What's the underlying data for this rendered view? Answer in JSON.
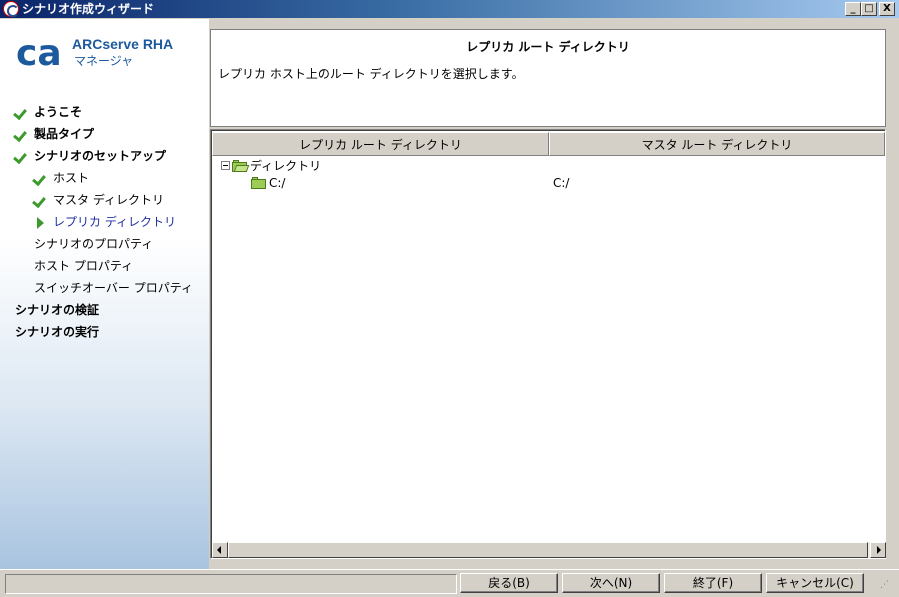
{
  "window": {
    "title": "シナリオ作成ウィザード",
    "controls": {
      "minimize": "_",
      "maximize": "□",
      "close": "X"
    }
  },
  "brand": {
    "logo_text": "ca",
    "product": "ARCserve RHA",
    "subtitle": "マネージャ"
  },
  "steps": [
    {
      "label": "ようこそ",
      "status": "done",
      "level": 0
    },
    {
      "label": "製品タイプ",
      "status": "done",
      "level": 0
    },
    {
      "label": "シナリオのセットアップ",
      "status": "done",
      "level": 0
    },
    {
      "label": "ホスト",
      "status": "done",
      "level": 1
    },
    {
      "label": "マスタ ディレクトリ",
      "status": "done",
      "level": 1
    },
    {
      "label": "レプリカ ディレクトリ",
      "status": "current",
      "level": 1
    },
    {
      "label": "シナリオのプロパティ",
      "status": "pending",
      "level": 1
    },
    {
      "label": "ホスト プロパティ",
      "status": "pending",
      "level": 1
    },
    {
      "label": "スイッチオーバー プロパティ",
      "status": "pending",
      "level": 1
    },
    {
      "label": "シナリオの検証",
      "status": "pending",
      "level": 0
    },
    {
      "label": "シナリオの実行",
      "status": "pending",
      "level": 0
    }
  ],
  "header": {
    "title": "レプリカ ルート ディレクトリ",
    "description": "レプリカ ホスト上のルート ディレクトリを選択します。"
  },
  "table": {
    "columns": [
      "レプリカ ルート ディレクトリ",
      "マスタ ルート ディレクトリ"
    ],
    "tree": {
      "root_label": "ディレクトリ",
      "rows": [
        {
          "replica": "C:/",
          "master": "C:/"
        }
      ]
    }
  },
  "buttons": {
    "back": "戻る(B)",
    "next": "次へ(N)",
    "finish": "終了(F)",
    "cancel": "キャンセル(C)"
  },
  "colors": {
    "accent": "#1d5a9d",
    "check": "#3c9a2c",
    "current_step": "#1f2fa0"
  }
}
